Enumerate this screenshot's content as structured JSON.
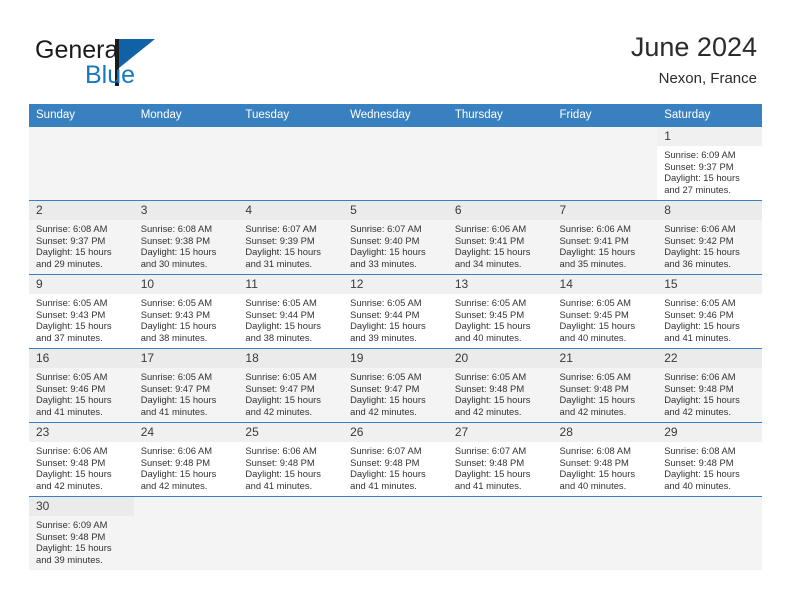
{
  "brand": {
    "name_top": "General",
    "name_bottom": "Blue",
    "mark": "triangle-logo"
  },
  "header": {
    "title": "June 2024",
    "location": "Nexon, France"
  },
  "calendar": {
    "weekdays": [
      "Sunday",
      "Monday",
      "Tuesday",
      "Wednesday",
      "Thursday",
      "Friday",
      "Saturday"
    ],
    "labels": {
      "sunrise": "Sunrise:",
      "sunset": "Sunset:",
      "daylight": "Daylight:"
    },
    "weeks": [
      [
        {
          "day": ""
        },
        {
          "day": ""
        },
        {
          "day": ""
        },
        {
          "day": ""
        },
        {
          "day": ""
        },
        {
          "day": ""
        },
        {
          "day": "1",
          "sunrise": "Sunrise: 6:09 AM",
          "sunset": "Sunset: 9:37 PM",
          "daylight1": "Daylight: 15 hours",
          "daylight2": "and 27 minutes."
        }
      ],
      [
        {
          "day": "2",
          "sunrise": "Sunrise: 6:08 AM",
          "sunset": "Sunset: 9:37 PM",
          "daylight1": "Daylight: 15 hours",
          "daylight2": "and 29 minutes."
        },
        {
          "day": "3",
          "sunrise": "Sunrise: 6:08 AM",
          "sunset": "Sunset: 9:38 PM",
          "daylight1": "Daylight: 15 hours",
          "daylight2": "and 30 minutes."
        },
        {
          "day": "4",
          "sunrise": "Sunrise: 6:07 AM",
          "sunset": "Sunset: 9:39 PM",
          "daylight1": "Daylight: 15 hours",
          "daylight2": "and 31 minutes."
        },
        {
          "day": "5",
          "sunrise": "Sunrise: 6:07 AM",
          "sunset": "Sunset: 9:40 PM",
          "daylight1": "Daylight: 15 hours",
          "daylight2": "and 33 minutes."
        },
        {
          "day": "6",
          "sunrise": "Sunrise: 6:06 AM",
          "sunset": "Sunset: 9:41 PM",
          "daylight1": "Daylight: 15 hours",
          "daylight2": "and 34 minutes."
        },
        {
          "day": "7",
          "sunrise": "Sunrise: 6:06 AM",
          "sunset": "Sunset: 9:41 PM",
          "daylight1": "Daylight: 15 hours",
          "daylight2": "and 35 minutes."
        },
        {
          "day": "8",
          "sunrise": "Sunrise: 6:06 AM",
          "sunset": "Sunset: 9:42 PM",
          "daylight1": "Daylight: 15 hours",
          "daylight2": "and 36 minutes."
        }
      ],
      [
        {
          "day": "9",
          "sunrise": "Sunrise: 6:05 AM",
          "sunset": "Sunset: 9:43 PM",
          "daylight1": "Daylight: 15 hours",
          "daylight2": "and 37 minutes."
        },
        {
          "day": "10",
          "sunrise": "Sunrise: 6:05 AM",
          "sunset": "Sunset: 9:43 PM",
          "daylight1": "Daylight: 15 hours",
          "daylight2": "and 38 minutes."
        },
        {
          "day": "11",
          "sunrise": "Sunrise: 6:05 AM",
          "sunset": "Sunset: 9:44 PM",
          "daylight1": "Daylight: 15 hours",
          "daylight2": "and 38 minutes."
        },
        {
          "day": "12",
          "sunrise": "Sunrise: 6:05 AM",
          "sunset": "Sunset: 9:44 PM",
          "daylight1": "Daylight: 15 hours",
          "daylight2": "and 39 minutes."
        },
        {
          "day": "13",
          "sunrise": "Sunrise: 6:05 AM",
          "sunset": "Sunset: 9:45 PM",
          "daylight1": "Daylight: 15 hours",
          "daylight2": "and 40 minutes."
        },
        {
          "day": "14",
          "sunrise": "Sunrise: 6:05 AM",
          "sunset": "Sunset: 9:45 PM",
          "daylight1": "Daylight: 15 hours",
          "daylight2": "and 40 minutes."
        },
        {
          "day": "15",
          "sunrise": "Sunrise: 6:05 AM",
          "sunset": "Sunset: 9:46 PM",
          "daylight1": "Daylight: 15 hours",
          "daylight2": "and 41 minutes."
        }
      ],
      [
        {
          "day": "16",
          "sunrise": "Sunrise: 6:05 AM",
          "sunset": "Sunset: 9:46 PM",
          "daylight1": "Daylight: 15 hours",
          "daylight2": "and 41 minutes."
        },
        {
          "day": "17",
          "sunrise": "Sunrise: 6:05 AM",
          "sunset": "Sunset: 9:47 PM",
          "daylight1": "Daylight: 15 hours",
          "daylight2": "and 41 minutes."
        },
        {
          "day": "18",
          "sunrise": "Sunrise: 6:05 AM",
          "sunset": "Sunset: 9:47 PM",
          "daylight1": "Daylight: 15 hours",
          "daylight2": "and 42 minutes."
        },
        {
          "day": "19",
          "sunrise": "Sunrise: 6:05 AM",
          "sunset": "Sunset: 9:47 PM",
          "daylight1": "Daylight: 15 hours",
          "daylight2": "and 42 minutes."
        },
        {
          "day": "20",
          "sunrise": "Sunrise: 6:05 AM",
          "sunset": "Sunset: 9:48 PM",
          "daylight1": "Daylight: 15 hours",
          "daylight2": "and 42 minutes."
        },
        {
          "day": "21",
          "sunrise": "Sunrise: 6:05 AM",
          "sunset": "Sunset: 9:48 PM",
          "daylight1": "Daylight: 15 hours",
          "daylight2": "and 42 minutes."
        },
        {
          "day": "22",
          "sunrise": "Sunrise: 6:06 AM",
          "sunset": "Sunset: 9:48 PM",
          "daylight1": "Daylight: 15 hours",
          "daylight2": "and 42 minutes."
        }
      ],
      [
        {
          "day": "23",
          "sunrise": "Sunrise: 6:06 AM",
          "sunset": "Sunset: 9:48 PM",
          "daylight1": "Daylight: 15 hours",
          "daylight2": "and 42 minutes."
        },
        {
          "day": "24",
          "sunrise": "Sunrise: 6:06 AM",
          "sunset": "Sunset: 9:48 PM",
          "daylight1": "Daylight: 15 hours",
          "daylight2": "and 42 minutes."
        },
        {
          "day": "25",
          "sunrise": "Sunrise: 6:06 AM",
          "sunset": "Sunset: 9:48 PM",
          "daylight1": "Daylight: 15 hours",
          "daylight2": "and 41 minutes."
        },
        {
          "day": "26",
          "sunrise": "Sunrise: 6:07 AM",
          "sunset": "Sunset: 9:48 PM",
          "daylight1": "Daylight: 15 hours",
          "daylight2": "and 41 minutes."
        },
        {
          "day": "27",
          "sunrise": "Sunrise: 6:07 AM",
          "sunset": "Sunset: 9:48 PM",
          "daylight1": "Daylight: 15 hours",
          "daylight2": "and 41 minutes."
        },
        {
          "day": "28",
          "sunrise": "Sunrise: 6:08 AM",
          "sunset": "Sunset: 9:48 PM",
          "daylight1": "Daylight: 15 hours",
          "daylight2": "and 40 minutes."
        },
        {
          "day": "29",
          "sunrise": "Sunrise: 6:08 AM",
          "sunset": "Sunset: 9:48 PM",
          "daylight1": "Daylight: 15 hours",
          "daylight2": "and 40 minutes."
        }
      ],
      [
        {
          "day": "30",
          "sunrise": "Sunrise: 6:09 AM",
          "sunset": "Sunset: 9:48 PM",
          "daylight1": "Daylight: 15 hours",
          "daylight2": "and 39 minutes."
        },
        {
          "day": ""
        },
        {
          "day": ""
        },
        {
          "day": ""
        },
        {
          "day": ""
        },
        {
          "day": ""
        },
        {
          "day": ""
        }
      ]
    ]
  },
  "colors": {
    "header_blue": "#3980c0",
    "logo_blue": "#1161a6",
    "text": "#333333",
    "row_alt": "#f4f4f4"
  }
}
